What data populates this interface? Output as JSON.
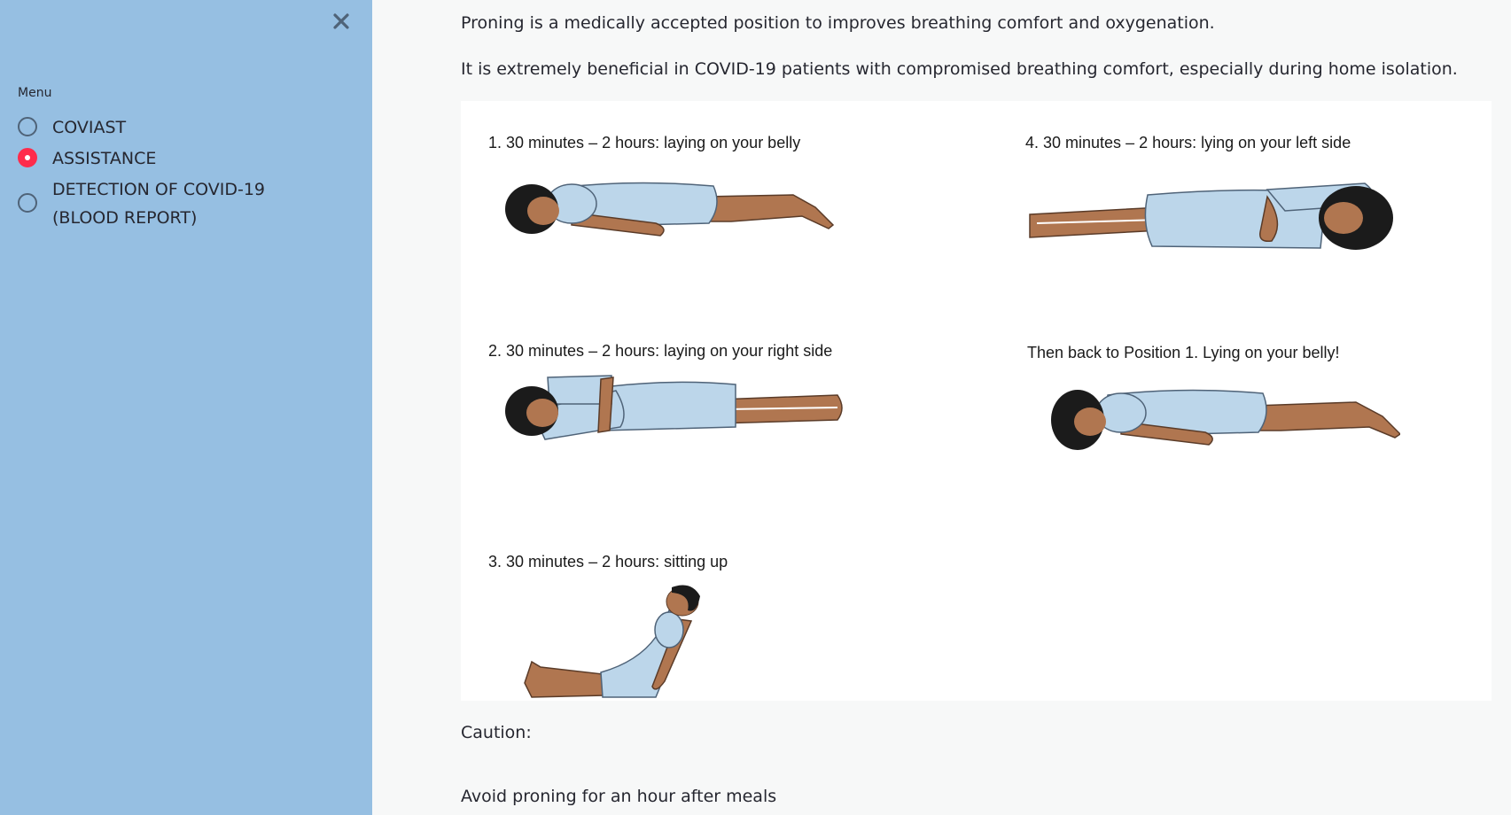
{
  "sidebar": {
    "menu_label": "Menu",
    "close_icon": "close-icon",
    "options": [
      {
        "label": "COVIAST",
        "selected": false
      },
      {
        "label": "ASSISTANCE",
        "selected": true
      },
      {
        "label": "DETECTION OF COVID-19 (BLOOD REPORT)",
        "selected": false
      }
    ],
    "accent_color": "#ff2b4b",
    "background_color": "#96bfe2"
  },
  "main": {
    "intro": "Proning is a medically accepted position to improves breathing comfort and oxygenation.",
    "benefit": "It is extremely beneficial in COVID-19 patients with compromised breathing comfort, especially during home isolation.",
    "figure": {
      "pos1": "1.    30 minutes – 2 hours: laying on your belly",
      "pos2": "2.    30 minutes – 2 hours: laying on your right side",
      "pos3": "3. 30 minutes – 2 hours: sitting up",
      "pos4": "4. 30 minutes – 2 hours: lying on your left side",
      "pos5": "Then back to Position 1. Lying on your belly!"
    },
    "caution_label": "Caution:",
    "caution_item": "Avoid proning for an hour after meals"
  }
}
